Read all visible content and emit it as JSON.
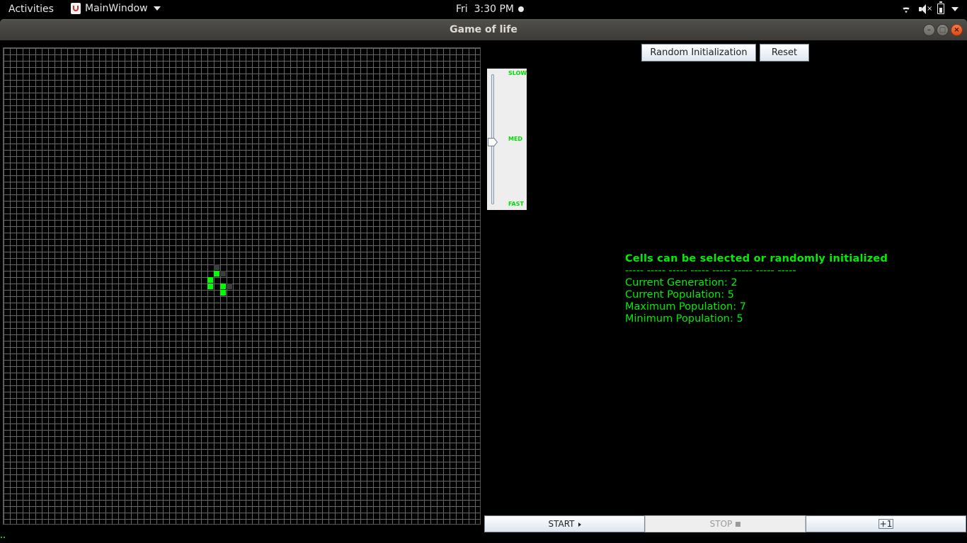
{
  "topbar": {
    "activities": "Activities",
    "app_menu": "MainWindow",
    "clock": "Fri  3:30 PM",
    "tray_icons": [
      "wifi-icon",
      "volume-muted-icon",
      "battery-icon",
      "power-menu-icon"
    ]
  },
  "window": {
    "title": "Game of life",
    "controls": [
      "minimize",
      "maximize",
      "close"
    ]
  },
  "grid": {
    "columns": 75,
    "rows": 75,
    "alive_cells": [
      [
        33,
        35
      ],
      [
        32,
        36
      ],
      [
        32,
        37
      ],
      [
        34,
        37
      ],
      [
        34,
        38
      ]
    ],
    "trail_cells": [
      [
        33,
        34
      ],
      [
        34,
        35
      ],
      [
        35,
        37
      ]
    ],
    "colors": {
      "alive": "#00ff00",
      "trail": "#3d3d3d",
      "grid_line": "#666666",
      "background": "#000000"
    }
  },
  "controls": {
    "random_init_label": "Random Initialization",
    "reset_label": "Reset",
    "start_label": "START",
    "stop_label": "STOP",
    "step_label": "+1"
  },
  "speed_slider": {
    "slow_label": "SLOW",
    "med_label": "MED",
    "fast_label": "FAST",
    "level": 0.5
  },
  "info": {
    "heading": "Cells can be selected or randomly initialized",
    "separator": "----- ----- ----- ----- ----- ----- ----- -----",
    "generation": "Current Generation: 2",
    "population": "Current Population: 5",
    "max_population": "Maximum Population: 7",
    "min_population": "Minimum Population: 5",
    "text_color": "#00ee00"
  }
}
